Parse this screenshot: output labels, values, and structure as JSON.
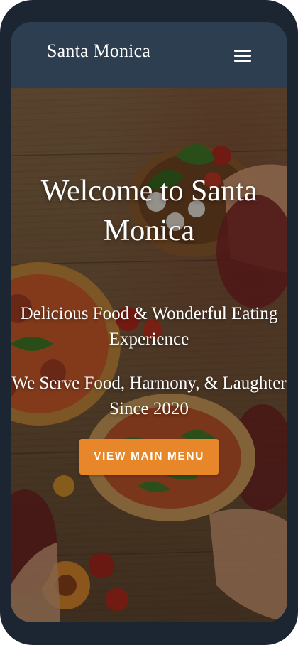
{
  "header": {
    "brand": "Santa Monica"
  },
  "hero": {
    "title": "Welcome to Santa Monica",
    "subtitle_1": "Delicious Food & Wonderful Eating Experience",
    "subtitle_2": "We Serve Food, Harmony, & Laughter Since 2020",
    "cta_label": "VIEW MAIN MENU"
  },
  "icons": {
    "menu": "hamburger-menu-icon"
  },
  "colors": {
    "device_frame": "#1c2633",
    "header_bg": "#2c3e50",
    "cta_bg": "#e8872a",
    "text": "#ffffff"
  }
}
